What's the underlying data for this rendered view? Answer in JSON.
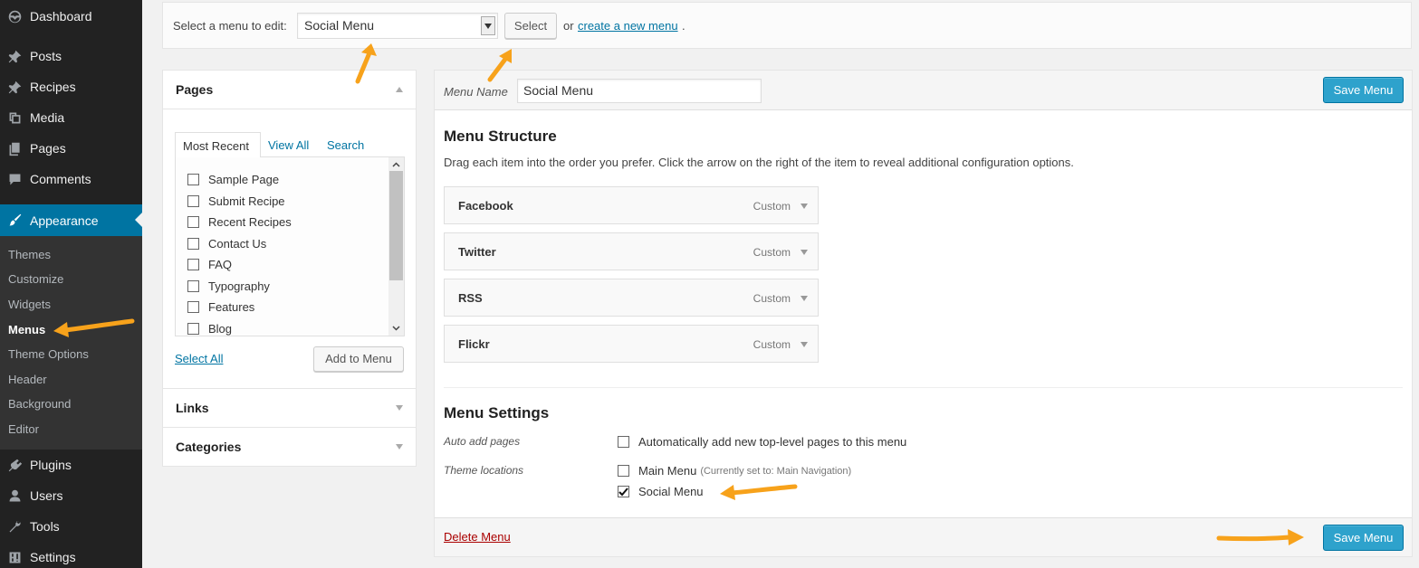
{
  "sidebar": {
    "top_items": [
      {
        "label": "Dashboard",
        "icon": "dashboard-icon"
      },
      {
        "label": "Posts",
        "icon": "pin-icon"
      },
      {
        "label": "Recipes",
        "icon": "pin-icon"
      },
      {
        "label": "Media",
        "icon": "media-icon"
      },
      {
        "label": "Pages",
        "icon": "pages-icon"
      },
      {
        "label": "Comments",
        "icon": "comments-icon"
      },
      {
        "label": "Appearance",
        "icon": "brush-icon"
      },
      {
        "label": "Plugins",
        "icon": "plugin-icon"
      },
      {
        "label": "Users",
        "icon": "users-icon"
      },
      {
        "label": "Tools",
        "icon": "wrench-icon"
      },
      {
        "label": "Settings",
        "icon": "settings-icon"
      }
    ],
    "active": "Appearance",
    "submenu": [
      "Themes",
      "Customize",
      "Widgets",
      "Menus",
      "Theme Options",
      "Header",
      "Background",
      "Editor"
    ],
    "current_sub": "Menus"
  },
  "select_bar": {
    "label": "Select a menu to edit:",
    "selected": "Social Menu",
    "select_button": "Select",
    "or_text": "or",
    "create_link": "create a new menu",
    "period": "."
  },
  "accordion": {
    "pages_title": "Pages",
    "tabs": [
      "Most Recent",
      "View All",
      "Search"
    ],
    "pages": [
      "Sample Page",
      "Submit Recipe",
      "Recent Recipes",
      "Contact Us",
      "FAQ",
      "Typography",
      "Features",
      "Blog"
    ],
    "select_all": "Select All",
    "add_to_menu": "Add to Menu",
    "links_title": "Links",
    "categories_title": "Categories"
  },
  "menu_panel": {
    "name_label": "Menu Name",
    "name_value": "Social Menu",
    "save_label": "Save Menu",
    "structure_title": "Menu Structure",
    "structure_desc": "Drag each item into the order you prefer. Click the arrow on the right of the item to reveal additional configuration options.",
    "items": [
      {
        "title": "Facebook",
        "type": "Custom"
      },
      {
        "title": "Twitter",
        "type": "Custom"
      },
      {
        "title": "RSS",
        "type": "Custom"
      },
      {
        "title": "Flickr",
        "type": "Custom"
      }
    ],
    "settings_title": "Menu Settings",
    "auto_add_label": "Auto add pages",
    "auto_add_option": "Automatically add new top-level pages to this menu",
    "auto_add_checked": false,
    "theme_locations_label": "Theme locations",
    "location_main": "Main Menu",
    "location_main_note": "(Currently set to: Main Navigation)",
    "location_main_checked": false,
    "location_social": "Social Menu",
    "location_social_checked": true,
    "delete_label": "Delete Menu"
  },
  "colors": {
    "sidebar_bg": "#222222",
    "active_blue": "#0074a2",
    "button_blue": "#2ea2cc",
    "annotation_orange": "#f7a21b",
    "delete_red": "#aa0000"
  }
}
